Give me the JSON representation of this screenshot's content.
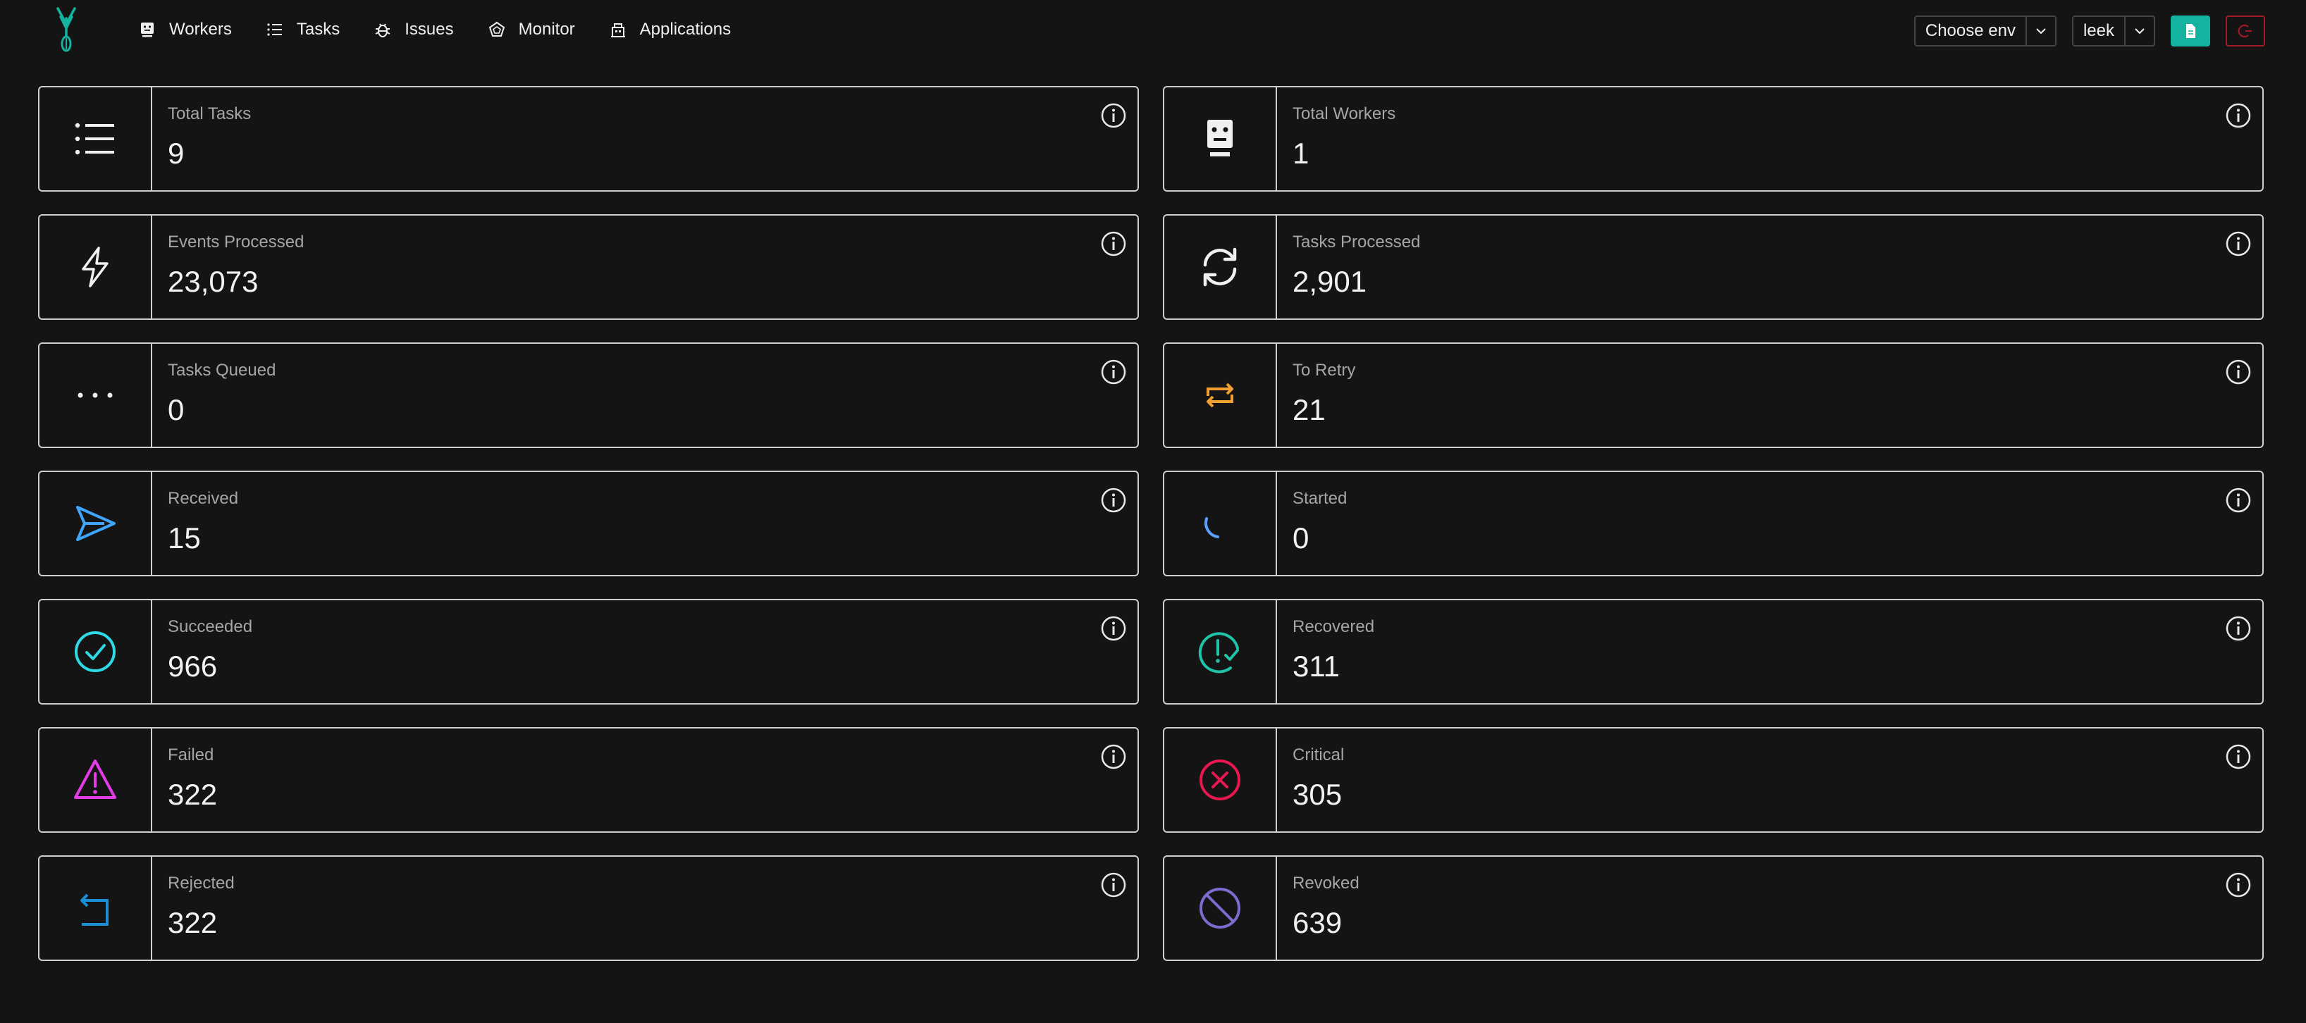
{
  "nav": {
    "items": [
      {
        "label": "Workers"
      },
      {
        "label": "Tasks"
      },
      {
        "label": "Issues"
      },
      {
        "label": "Monitor"
      },
      {
        "label": "Applications"
      }
    ]
  },
  "header": {
    "env_select": {
      "value": "Choose env"
    },
    "app_select": {
      "value": "leek"
    }
  },
  "colors": {
    "brand": "#13b3a0",
    "received": "#3fa5ff",
    "started": "#5aa0ff",
    "succeeded": "#2fd9e6",
    "recovered": "#1fc4a8",
    "failed": "#e23ce6",
    "critical": "#e8174f",
    "to_retry": "#f0a030",
    "rejected": "#1a8ed6",
    "revoked": "#7c6ccf"
  },
  "cards": [
    {
      "label": "Total Tasks",
      "value": "9",
      "icon": "list-icon"
    },
    {
      "label": "Total Workers",
      "value": "1",
      "icon": "robot-icon"
    },
    {
      "label": "Events Processed",
      "value": "23,073",
      "icon": "lightning-icon"
    },
    {
      "label": "Tasks Processed",
      "value": "2,901",
      "icon": "sync-icon"
    },
    {
      "label": "Tasks Queued",
      "value": "0",
      "icon": "ellipsis-icon"
    },
    {
      "label": "To Retry",
      "value": "21",
      "icon": "retry-icon"
    },
    {
      "label": "Received",
      "value": "15",
      "icon": "send-icon"
    },
    {
      "label": "Started",
      "value": "0",
      "icon": "loading-icon"
    },
    {
      "label": "Succeeded",
      "value": "966",
      "icon": "check-circle-icon"
    },
    {
      "label": "Recovered",
      "value": "311",
      "icon": "recovered-icon"
    },
    {
      "label": "Failed",
      "value": "322",
      "icon": "warning-icon"
    },
    {
      "label": "Critical",
      "value": "305",
      "icon": "close-circle-icon"
    },
    {
      "label": "Rejected",
      "value": "322",
      "icon": "rollback-icon"
    },
    {
      "label": "Revoked",
      "value": "639",
      "icon": "stop-icon"
    }
  ]
}
